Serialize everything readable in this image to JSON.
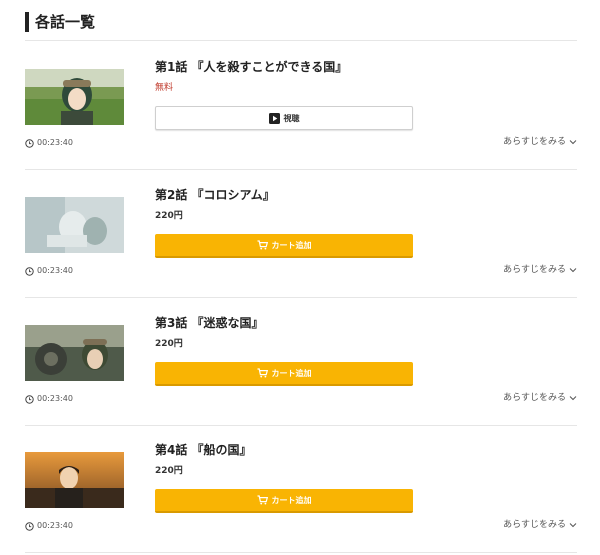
{
  "section": {
    "title": "各話一覧"
  },
  "episodes": [
    {
      "title": "第1話 『人を殺すことができる国』",
      "price": "無料",
      "button": "視聴",
      "button_icon": "play-icon",
      "duration": "00:23:40",
      "synopsis": "あらすじをみる"
    },
    {
      "title": "第2話 『コロシアム』",
      "price": "220円",
      "button": "カート追加",
      "button_icon": "cart-icon",
      "duration": "00:23:40",
      "synopsis": "あらすじをみる"
    },
    {
      "title": "第3話 『迷惑な国』",
      "price": "220円",
      "button": "カート追加",
      "button_icon": "cart-icon",
      "duration": "00:23:40",
      "synopsis": "あらすじをみる"
    },
    {
      "title": "第4話 『船の国』",
      "price": "220円",
      "button": "カート追加",
      "button_icon": "cart-icon",
      "duration": "00:23:40",
      "synopsis": "あらすじをみる"
    }
  ],
  "colors": {
    "accent": "#f9b403",
    "free": "#c0392b",
    "divider": "#e6e6e6"
  }
}
